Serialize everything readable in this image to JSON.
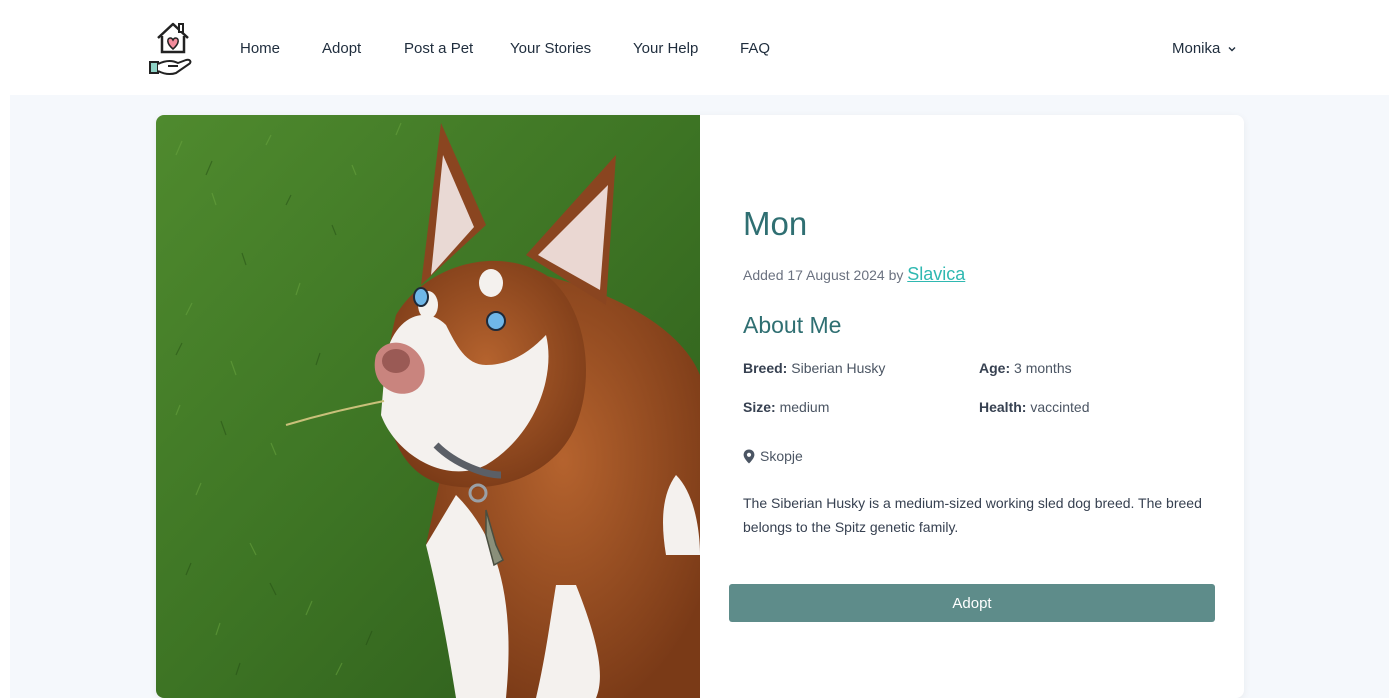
{
  "nav": {
    "links": [
      "Home",
      "Adopt",
      "Post a Pet",
      "Your Stories",
      "Your Help",
      "FAQ"
    ],
    "user": "Monika"
  },
  "pet": {
    "name": "Mon",
    "added_prefix": "Added 17 August 2024 by",
    "author": "Slavica",
    "about_title": "About Me",
    "breed_label": "Breed:",
    "breed": "Siberian Husky",
    "age_label": "Age:",
    "age": "3 months",
    "size_label": "Size:",
    "size": "medium",
    "health_label": "Health:",
    "health": "vaccinted",
    "location": "Skopje",
    "description": "The Siberian Husky is a medium-sized working sled dog breed. The breed belongs to the Spitz genetic family.",
    "adopt_label": "Adopt"
  },
  "colors": {
    "accent": "#2f6f72",
    "link": "#2fb8b1",
    "button": "#5e8c8a",
    "page_bg": "#f5f8fc"
  }
}
